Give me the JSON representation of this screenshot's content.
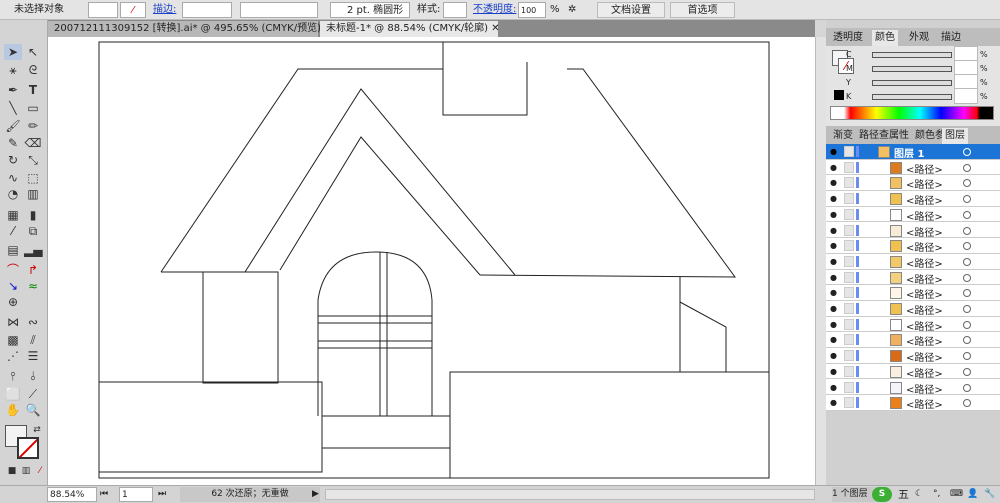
{
  "control_bar": {
    "selection": "未选择对象",
    "stroke_label": "描边:",
    "stroke_profile": "2 pt. 椭圆形",
    "style_label": "样式:",
    "opacity_label": "不透明度:",
    "opacity_value": "100",
    "opacity_unit": "%",
    "doc_setup": "文档设置",
    "preferences": "首选项"
  },
  "tabs": [
    {
      "label": "200712111309152 [转换].ai* @ 495.65% (CMYK/预览)",
      "active": false
    },
    {
      "label": "未标题-1* @ 88.54% (CMYK/轮廓)",
      "active": true
    }
  ],
  "color_panel": {
    "tabs": [
      "透明度",
      "颜色",
      "外观",
      "描边"
    ],
    "active": "颜色",
    "channels": [
      "C",
      "M",
      "Y",
      "K"
    ],
    "unit": "%"
  },
  "layers_panel": {
    "tabs": [
      "渐变",
      "路径查",
      "属性",
      "颜色参",
      "图层"
    ],
    "active": "图层",
    "layer_name": "图层 1",
    "accent": "#1b74d6",
    "items": [
      {
        "name": "<路径>",
        "thumb": "#e07a1e"
      },
      {
        "name": "<路径>",
        "thumb": "#f2c060"
      },
      {
        "name": "<路径>",
        "thumb": "#f0c050"
      },
      {
        "name": "<路径>",
        "thumb": "#ffffff"
      },
      {
        "name": "<路径>",
        "thumb": "#f8ecd8"
      },
      {
        "name": "<路径>",
        "thumb": "#f0c050"
      },
      {
        "name": "<路径>",
        "thumb": "#f2c868"
      },
      {
        "name": "<路径>",
        "thumb": "#f2d080"
      },
      {
        "name": "<路径>",
        "thumb": "#fff6ea"
      },
      {
        "name": "<路径>",
        "thumb": "#f0c050"
      },
      {
        "name": "<路径>",
        "thumb": "#ffffff"
      },
      {
        "name": "<路径>",
        "thumb": "#f0b060"
      },
      {
        "name": "<路径>",
        "thumb": "#d86a18"
      },
      {
        "name": "<路径>",
        "thumb": "#faf0e0"
      },
      {
        "name": "<路径>",
        "thumb": "#f4f4fa"
      },
      {
        "name": "<路径>",
        "thumb": "#e8801e"
      }
    ]
  },
  "status": {
    "zoom": "88.54%",
    "page": "1",
    "history": "62 次还原；无重做",
    "layers_count": "1 个图层"
  }
}
